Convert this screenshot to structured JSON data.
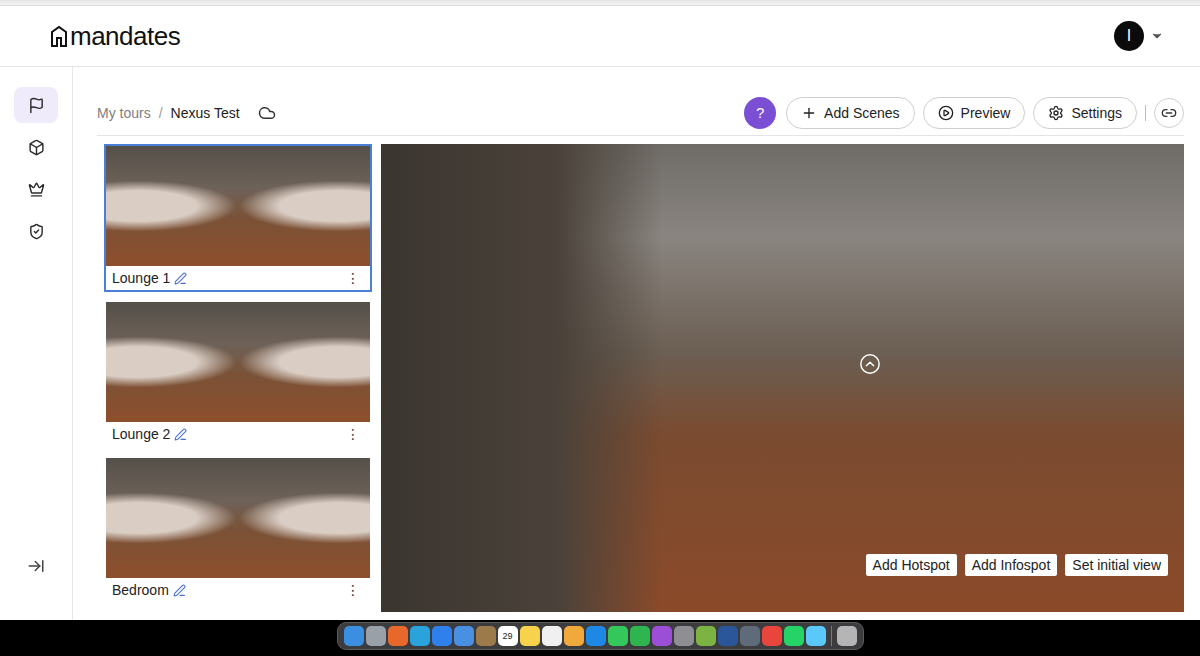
{
  "header": {
    "logo": "mandates",
    "avatar": "I"
  },
  "sidebar": {
    "items": [
      {
        "selected": true
      },
      {
        "selected": false
      },
      {
        "selected": false
      },
      {
        "selected": false
      }
    ]
  },
  "breadcrumb": {
    "root": "My tours",
    "separator": "/",
    "current": "Nexus Test"
  },
  "toolbar": {
    "help": "?",
    "buttons": [
      "Add Scenes",
      "Preview",
      "Settings"
    ]
  },
  "scenes": [
    {
      "label": "Lounge 1",
      "selected": true,
      "menu": "⋮"
    },
    {
      "label": "Lounge 2",
      "selected": false,
      "menu": "⋮"
    },
    {
      "label": "Bedroom",
      "selected": false,
      "menu": "⋮"
    }
  ],
  "viewer": {
    "actions": [
      "Add Hotspot",
      "Add Infospot",
      "Set initial view"
    ]
  },
  "dock": {
    "calendar_date": "29",
    "apps": [
      {
        "kind": "app",
        "color": "#3b8fe0"
      },
      {
        "kind": "app",
        "color": "#9aa0a8"
      },
      {
        "kind": "app",
        "color": "#e8672a"
      },
      {
        "kind": "app",
        "color": "#2aa3dd"
      },
      {
        "kind": "app",
        "color": "#2f80ed"
      },
      {
        "kind": "app",
        "color": "#4a90e2"
      },
      {
        "kind": "app",
        "color": "#9c7a4a"
      },
      {
        "kind": "calendar",
        "color": "#ffffff"
      },
      {
        "kind": "app",
        "color": "#f6d34a"
      },
      {
        "kind": "app",
        "color": "#f0f0f0"
      },
      {
        "kind": "app",
        "color": "#f2a93b"
      },
      {
        "kind": "app",
        "color": "#1e88e5"
      },
      {
        "kind": "app",
        "color": "#34c759"
      },
      {
        "kind": "app",
        "color": "#2fb54f"
      },
      {
        "kind": "app",
        "color": "#9b4fd6"
      },
      {
        "kind": "app",
        "color": "#8e8e93"
      },
      {
        "kind": "app",
        "color": "#7cb342"
      },
      {
        "kind": "app",
        "color": "#2b579a"
      },
      {
        "kind": "app",
        "color": "#5f6b7a"
      },
      {
        "kind": "app",
        "color": "#e8453c"
      },
      {
        "kind": "app",
        "color": "#25d366"
      },
      {
        "kind": "app",
        "color": "#5ac8fa"
      },
      {
        "kind": "trash",
        "color": "#b5b5b5"
      }
    ]
  }
}
